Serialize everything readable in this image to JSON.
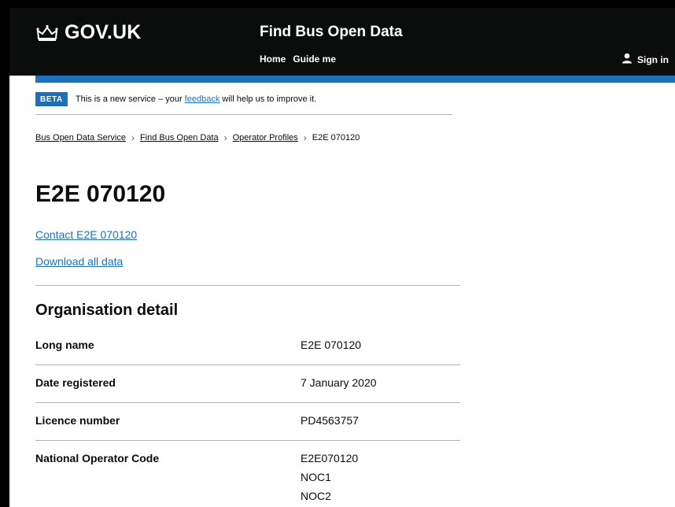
{
  "header": {
    "logo_text": "GOV.UK",
    "service_name": "Find Bus Open Data",
    "nav": [
      "Home",
      "Guide me"
    ],
    "signin": "Sign in"
  },
  "colors": {
    "header_bg": "#0b0c0c",
    "accent_blue": "#1d70b8",
    "text": "#0b0c0c",
    "border": "#b1b4b6"
  },
  "icons": {
    "logo": "crown-icon",
    "signin": "user-icon"
  },
  "phase_banner": {
    "tag": "BETA",
    "text_before": "This is a new service – your",
    "link": "feedback",
    "text_after": "will help us to improve it."
  },
  "breadcrumbs": [
    "Bus Open Data Service",
    "Find Bus Open Data",
    "Operator Profiles",
    "E2E 070120"
  ],
  "page_title": "E2E 070120",
  "links": {
    "contact": "Contact E2E 070120",
    "download": "Download all data"
  },
  "section_title": "Organisation detail",
  "details": [
    {
      "key": "Long name",
      "values": [
        "E2E 070120"
      ]
    },
    {
      "key": "Date registered",
      "values": [
        "7 January 2020"
      ]
    },
    {
      "key": "Licence number",
      "values": [
        "PD4563757"
      ]
    },
    {
      "key": "National Operator Code",
      "values": [
        "E2E070120",
        "NOC1",
        "NOC2"
      ]
    }
  ]
}
